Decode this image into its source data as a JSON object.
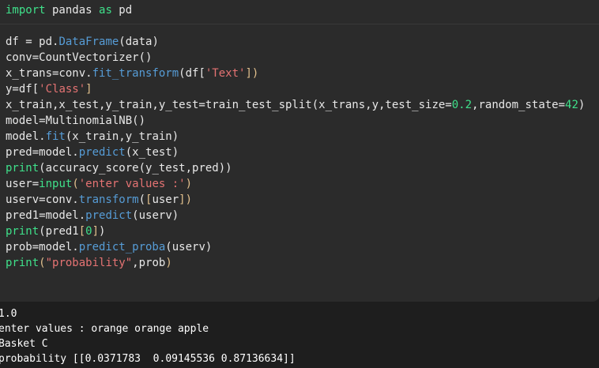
{
  "code_lines": [
    [
      [
        "kw",
        "import"
      ],
      [
        "txt",
        " pandas "
      ],
      [
        "kw",
        "as"
      ],
      [
        "txt",
        " pd"
      ]
    ],
    [],
    [
      [
        "txt",
        "df = pd."
      ],
      [
        "attr",
        "DataFrame"
      ],
      [
        "txt",
        "(data)"
      ]
    ],
    [
      [
        "txt",
        "conv=CountVectorizer()"
      ]
    ],
    [
      [
        "txt",
        "x_trans=conv."
      ],
      [
        "attr",
        "fit_transform"
      ],
      [
        "txt",
        "(df["
      ],
      [
        "str",
        "'Text'"
      ],
      [
        "br",
        "])"
      ]
    ],
    [
      [
        "txt",
        "y=df["
      ],
      [
        "str",
        "'Class'"
      ],
      [
        "br",
        "]"
      ]
    ],
    [
      [
        "txt",
        "x_train,x_test,y_train,y_test=train_test_split(x_trans,y,test_size="
      ],
      [
        "num",
        "0.2"
      ],
      [
        "txt",
        ",random_state="
      ],
      [
        "num",
        "42"
      ],
      [
        "txt",
        ")"
      ]
    ],
    [
      [
        "txt",
        "model=MultinomialNB()"
      ]
    ],
    [
      [
        "txt",
        "model."
      ],
      [
        "attr",
        "fit"
      ],
      [
        "txt",
        "(x_train,y_train)"
      ]
    ],
    [
      [
        "txt",
        "pred=model."
      ],
      [
        "attr",
        "predict"
      ],
      [
        "txt",
        "(x_test)"
      ]
    ],
    [
      [
        "kw",
        "print"
      ],
      [
        "txt",
        "(accuracy_score(y_test,pred))"
      ]
    ],
    [
      [
        "txt",
        "user="
      ],
      [
        "kw",
        "input"
      ],
      [
        "br",
        "("
      ],
      [
        "str",
        "'enter values :'"
      ],
      [
        "br",
        ")"
      ]
    ],
    [
      [
        "txt",
        "userv=conv."
      ],
      [
        "attr",
        "transform"
      ],
      [
        "txt",
        "("
      ],
      [
        "br",
        "["
      ],
      [
        "txt",
        "user"
      ],
      [
        "br",
        "])"
      ]
    ],
    [
      [
        "txt",
        "pred1=model."
      ],
      [
        "attr",
        "predict"
      ],
      [
        "txt",
        "(userv)"
      ]
    ],
    [
      [
        "kw",
        "print"
      ],
      [
        "txt",
        "(pred1"
      ],
      [
        "br",
        "["
      ],
      [
        "num",
        "0"
      ],
      [
        "br",
        "]"
      ],
      [
        "txt",
        ")"
      ]
    ],
    [
      [
        "txt",
        "prob=model."
      ],
      [
        "attr",
        "predict_proba"
      ],
      [
        "txt",
        "(userv)"
      ]
    ],
    [
      [
        "kw",
        "print"
      ],
      [
        "br",
        "("
      ],
      [
        "str",
        "\"probability\""
      ],
      [
        "txt",
        ",prob"
      ],
      [
        "br",
        ")"
      ]
    ]
  ],
  "output": {
    "line1": "1.0",
    "line2": "enter values : orange orange apple",
    "line3": "Basket C",
    "line4": "probability [[0.0371783  0.09145536 0.87136634]]"
  },
  "colors": {
    "editor_bg": "#2b2b2b",
    "output_bg": "#1e1e1e",
    "keyword": "#3fe08a",
    "attribute": "#569cd6",
    "string": "#e57373"
  }
}
